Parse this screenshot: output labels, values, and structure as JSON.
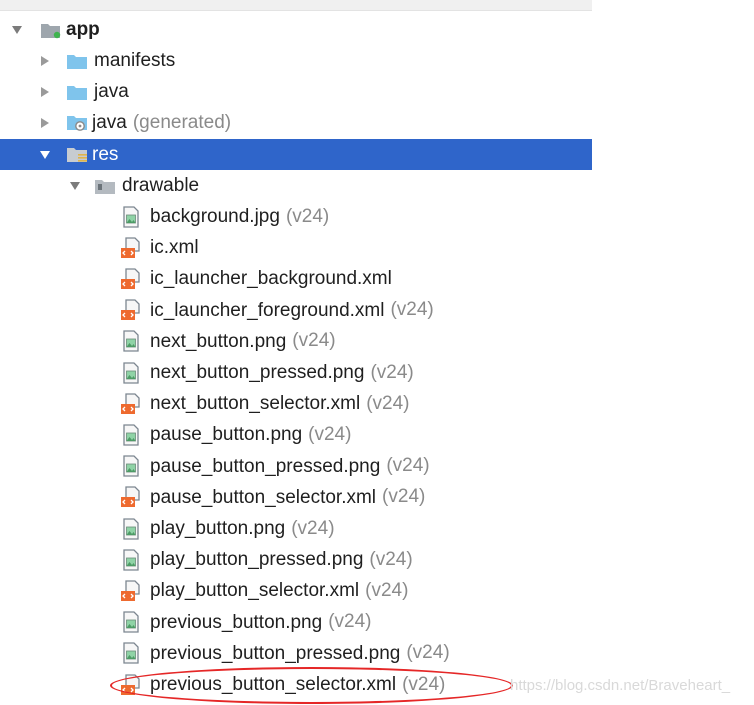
{
  "tree": {
    "root": {
      "label": "app"
    },
    "top_folders": [
      {
        "label": "manifests",
        "suffix": ""
      },
      {
        "label": "java",
        "suffix": ""
      },
      {
        "label": "java",
        "suffix": "(generated)"
      },
      {
        "label": "res",
        "suffix": ""
      }
    ],
    "drawable": {
      "label": "drawable"
    },
    "files": [
      {
        "label": "background.jpg",
        "suffix": "(v24)",
        "type": "image-file-icon"
      },
      {
        "label": "ic.xml",
        "suffix": "",
        "type": "xml-file-icon"
      },
      {
        "label": "ic_launcher_background.xml",
        "suffix": "",
        "type": "xml-file-icon"
      },
      {
        "label": "ic_launcher_foreground.xml",
        "suffix": "(v24)",
        "type": "xml-file-icon"
      },
      {
        "label": "next_button.png",
        "suffix": "(v24)",
        "type": "image-file-icon"
      },
      {
        "label": "next_button_pressed.png",
        "suffix": "(v24)",
        "type": "image-file-icon"
      },
      {
        "label": "next_button_selector.xml",
        "suffix": "(v24)",
        "type": "xml-file-icon"
      },
      {
        "label": "pause_button.png",
        "suffix": "(v24)",
        "type": "image-file-icon"
      },
      {
        "label": "pause_button_pressed.png",
        "suffix": "(v24)",
        "type": "image-file-icon"
      },
      {
        "label": "pause_button_selector.xml",
        "suffix": "(v24)",
        "type": "xml-file-icon"
      },
      {
        "label": "play_button.png",
        "suffix": "(v24)",
        "type": "image-file-icon"
      },
      {
        "label": "play_button_pressed.png",
        "suffix": "(v24)",
        "type": "image-file-icon"
      },
      {
        "label": "play_button_selector.xml",
        "suffix": "(v24)",
        "type": "xml-file-icon"
      },
      {
        "label": "previous_button.png",
        "suffix": "(v24)",
        "type": "image-file-icon"
      },
      {
        "label": "previous_button_pressed.png",
        "suffix": "(v24)",
        "type": "image-file-icon"
      },
      {
        "label": "previous_button_selector.xml",
        "suffix": "(v24)",
        "type": "xml-file-icon"
      }
    ]
  },
  "watermark": "https://blog.csdn.net/Braveheart_",
  "colors": {
    "selection": "#2f65ca",
    "highlight_ring": "#e52727",
    "muted_text": "#8a8a8a"
  }
}
